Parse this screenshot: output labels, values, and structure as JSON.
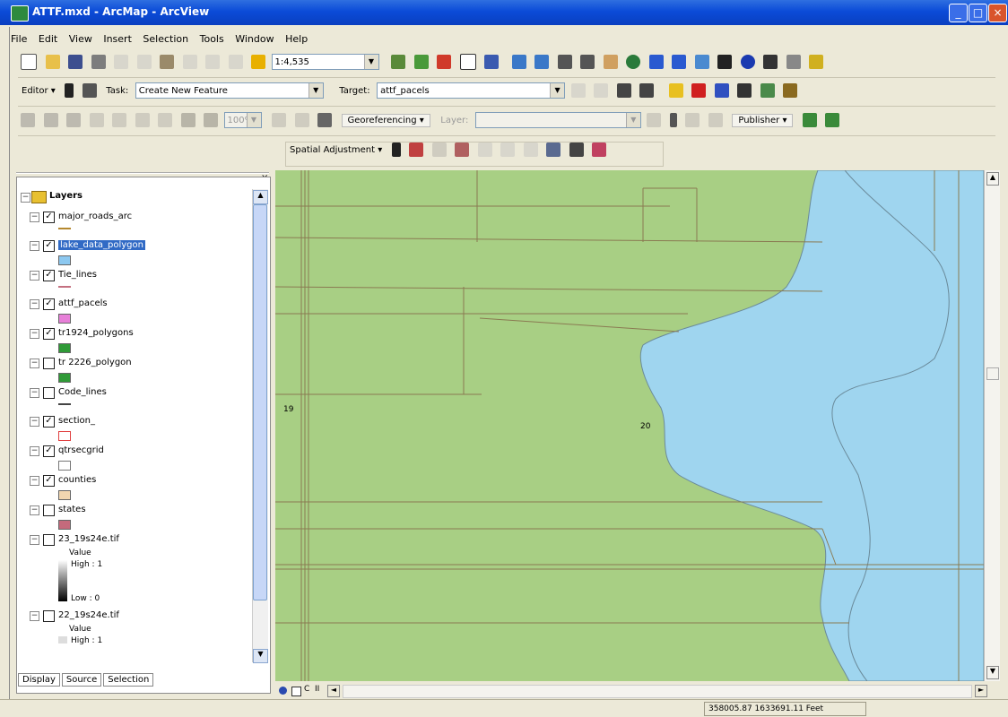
{
  "window": {
    "title": "ATTF.mxd - ArcMap - ArcView",
    "controls": [
      "_",
      "□",
      "×"
    ]
  },
  "menu": [
    "File",
    "Edit",
    "View",
    "Insert",
    "Selection",
    "Tools",
    "Window",
    "Help"
  ],
  "standard_toolbar": {
    "scale_value": "1:4,535"
  },
  "editor_toolbar": {
    "editor_label": "Editor ▾",
    "task_label": "Task:",
    "task_value": "Create New Feature",
    "target_label": "Target:",
    "target_value": "attf_pacels"
  },
  "georef_toolbar": {
    "zoom_value": "100%",
    "georeferencing_label": "Georeferencing ▾",
    "layer_label": "Layer:",
    "publisher_label": "Publisher ▾"
  },
  "spatial_toolbar": {
    "label": "Spatial Adjustment ▾"
  },
  "toc": {
    "root_label": "Layers",
    "layers": [
      {
        "name": "major_roads_arc",
        "checked": true,
        "symbol": "line",
        "color": "#b5882e"
      },
      {
        "name": "lake_data_polygon",
        "checked": true,
        "symbol": "fill",
        "color": "#8cc8f0",
        "selected": true
      },
      {
        "name": "Tie_lines",
        "checked": true,
        "symbol": "line",
        "color": "#c47080"
      },
      {
        "name": "attf_pacels",
        "checked": true,
        "symbol": "fill",
        "color": "#e77fd8"
      },
      {
        "name": "tr1924_polygons",
        "checked": true,
        "symbol": "fill",
        "color": "#2f9a37"
      },
      {
        "name": "tr 2226_polygon",
        "checked": false,
        "symbol": "fill",
        "color": "#2f9a37"
      },
      {
        "name": "Code_lines",
        "checked": false,
        "symbol": "line",
        "color": "#444444"
      },
      {
        "name": "section_",
        "checked": true,
        "symbol": "outline",
        "color": "#e04040"
      },
      {
        "name": "qtrsecgrid",
        "checked": true,
        "symbol": "outline",
        "color": "#777777"
      },
      {
        "name": "counties",
        "checked": true,
        "symbol": "fill",
        "color": "#f1d6b0"
      },
      {
        "name": "states",
        "checked": false,
        "symbol": "fill",
        "color": "#c46a7c"
      },
      {
        "name": "23_19s24e.tif",
        "checked": false,
        "symbol": "raster",
        "value_label": "Value",
        "high_label": "High : 1",
        "low_label": "Low : 0"
      },
      {
        "name": "22_19s24e.tif",
        "checked": false,
        "symbol": "raster2",
        "value_label": "Value",
        "high_label": "High : 1"
      }
    ],
    "tabs": [
      "Display",
      "Source",
      "Selection"
    ]
  },
  "map": {
    "label_19": "19",
    "label_20": "20",
    "land_color": "#a8cf84",
    "water_color": "#9fd5ef",
    "line_color": "#8a7a52"
  },
  "status": {
    "coords": "358005.87 1633691.11 Feet"
  }
}
